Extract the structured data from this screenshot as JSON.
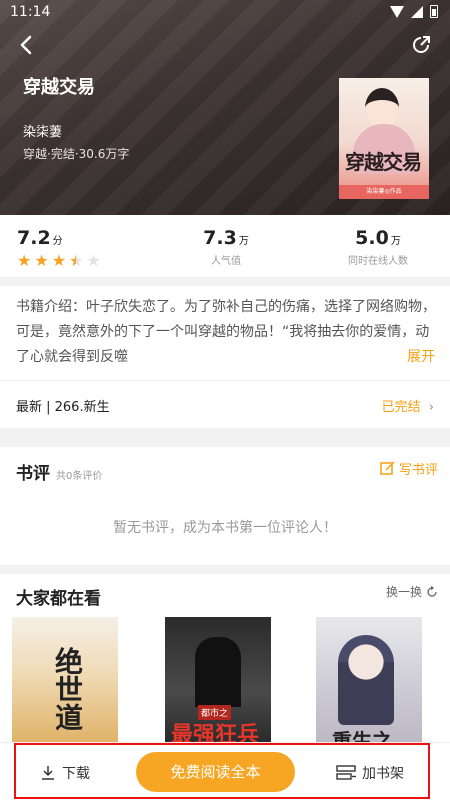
{
  "status_bar": {
    "time": "11:14"
  },
  "header": {
    "title": "穿越交易",
    "author": "染柒萋",
    "meta": "穿越·完结·30.6万字",
    "cover_title": "穿越交易",
    "cover_footer": "染柒萋◎作品"
  },
  "stats": {
    "rating_value": "7.2",
    "rating_unit": "分",
    "rating_stars": 3.5,
    "popularity_value": "7.3",
    "popularity_unit": "万",
    "popularity_label": "人气值",
    "online_value": "5.0",
    "online_unit": "万",
    "online_label": "同时在线人数"
  },
  "intro": {
    "text": "书籍介绍：叶子欣失恋了。为了弥补自己的伤痛，选择了网络购物，可是，竟然意外的下了一个叫穿越的物品！“我将抽去你的爱情，动了心就会得到反噬",
    "expand_label": "展开",
    "latest_label": "最新 | 266.新生",
    "status_label": "已完结"
  },
  "review": {
    "title": "书评",
    "count": "共0条评价",
    "write_label": "写书评",
    "empty_text": "暂无书评，成为本书第一位评论人！"
  },
  "recommend": {
    "title": "大家都在看",
    "refresh_label": "换一换",
    "books": [
      {
        "cover_text": "绝世道"
      },
      {
        "cover_tag": "都市之",
        "cover_text": "最强狂兵"
      },
      {
        "cover_text": "重生之"
      }
    ]
  },
  "bottom": {
    "download_label": "下载",
    "read_label": "免费阅读全本",
    "shelf_label": "加书架"
  },
  "colors": {
    "accent": "#f7a623",
    "highlight_box": "#e11111"
  }
}
